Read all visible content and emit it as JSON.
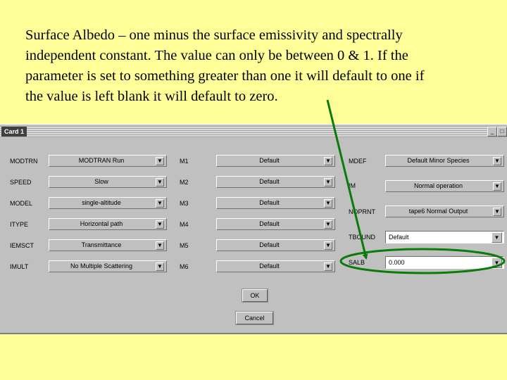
{
  "caption": {
    "lines": [
      "Surface Albedo – one minus the surface emissivity and spectrally",
      "independent constant.  The value can only be between 0 & 1.  If the",
      "parameter is set to something greater than one it will default to one if",
      "the value is left blank it will default to zero."
    ]
  },
  "window": {
    "title": "Card 1",
    "minimize": "_",
    "close": "□"
  },
  "left_col": [
    {
      "label": "MODTRN",
      "value": "MODTRAN Run"
    },
    {
      "label": "SPEED",
      "value": "Slow"
    },
    {
      "label": "MODEL",
      "value": "single-altitude"
    },
    {
      "label": "ITYPE",
      "value": "Horizontal path"
    },
    {
      "label": "IEMSCT",
      "value": "Transmittance"
    },
    {
      "label": "IMULT",
      "value": "No Multiple Scattering"
    }
  ],
  "mid_col": [
    {
      "label": "M1",
      "value": "Default"
    },
    {
      "label": "M2",
      "value": "Default"
    },
    {
      "label": "M3",
      "value": "Default"
    },
    {
      "label": "M4",
      "value": "Default"
    },
    {
      "label": "M5",
      "value": "Default"
    },
    {
      "label": "M6",
      "value": "Default"
    }
  ],
  "right_col": {
    "mdef": {
      "label": "MDEF",
      "value": "Default Minor Species"
    },
    "im": {
      "label": "IM",
      "value": "Normal operation"
    },
    "noprnt": {
      "label": "NOPRNT",
      "value": "tape6 Normal Output"
    },
    "tbound": {
      "label": "TBOUND",
      "value": "Default"
    },
    "salb": {
      "label": "SALB",
      "value": "0.000"
    }
  },
  "buttons": {
    "ok": "OK",
    "cancel": "Cancel"
  },
  "icons": {
    "dropdown": "dropdown-arrow-icon"
  },
  "annotation": {
    "color": "#0a7a0a"
  }
}
